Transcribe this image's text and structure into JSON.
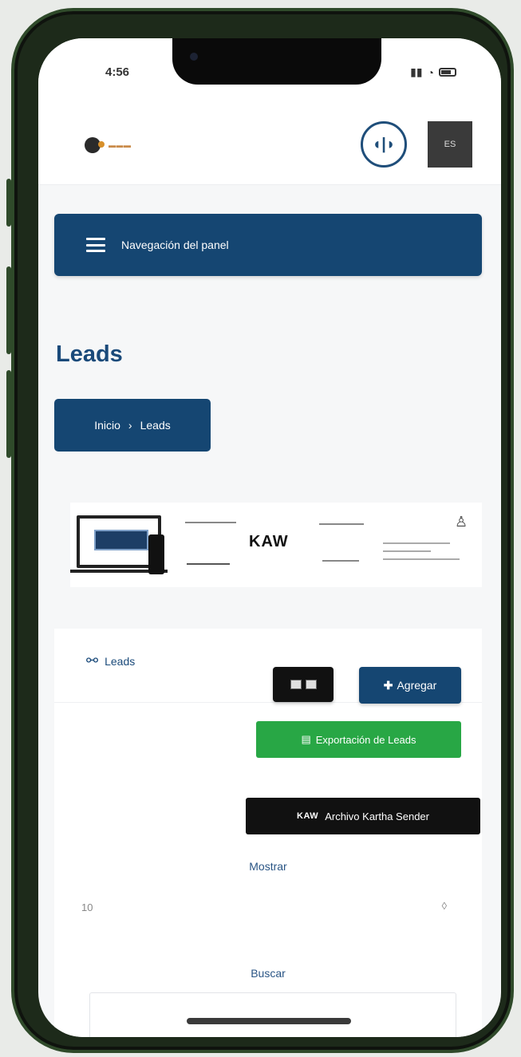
{
  "status_bar": {
    "time": "4:56"
  },
  "header": {
    "lang_label": "ES"
  },
  "nav_button": {
    "label": "Navegación del panel"
  },
  "page": {
    "title": "Leads"
  },
  "breadcrumb": {
    "home": "Inicio",
    "separator": "›",
    "current": "Leads"
  },
  "banner": {
    "mid_brand": "KAW"
  },
  "card": {
    "title": "Leads",
    "add_label": "Agregar",
    "export_label": "Exportación de Leads",
    "archive_brand": "KAW",
    "archive_label": "Archivo Kartha Sender",
    "show_label": "Mostrar",
    "show_value": "10",
    "search_label": "Buscar"
  },
  "colors": {
    "primary": "#154672",
    "success": "#28a745",
    "dark": "#111111"
  }
}
